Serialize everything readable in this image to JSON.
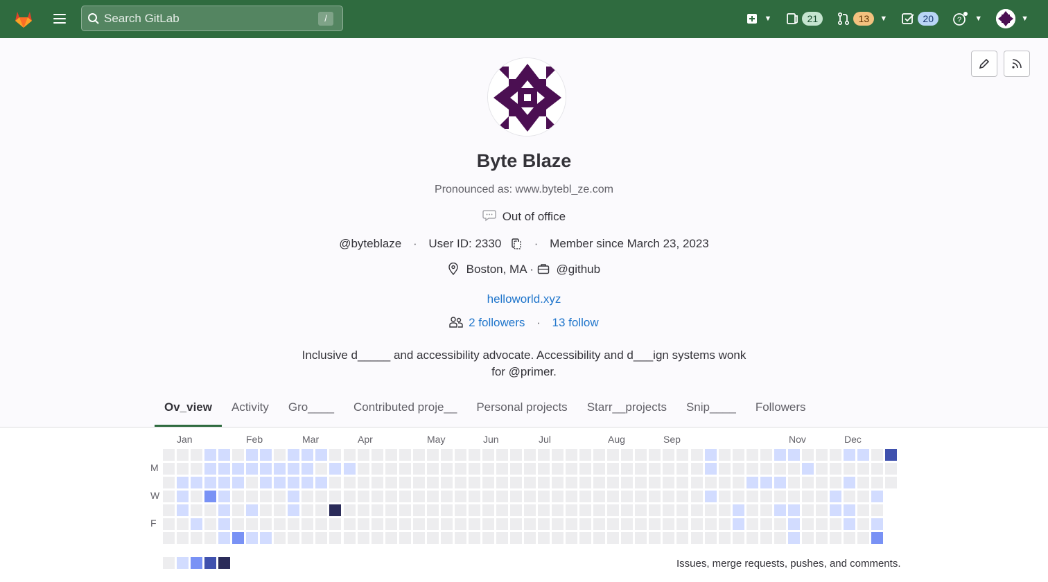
{
  "topbar": {
    "search_placeholder": "Search GitLab",
    "search_shortcut": "/",
    "issues_count": "21",
    "merge_requests_count": "13",
    "todos_count": "20"
  },
  "profile": {
    "name": "Byte Blaze",
    "pronounced": "Pronounced as: www.bytebl_ze.com",
    "status_text": "Out of office",
    "username": "@byteblaze",
    "user_id": "User ID: 2330",
    "member_since": "Member since March 23, 2023",
    "location": "Boston, MA",
    "organization": "@github",
    "website": "helloworld.xyz",
    "followers": "2 followers",
    "following": "13 follow",
    "bio": "Inclusive d_____ and accessibility advocate. Accessibility and d___ign systems wonk for @primer."
  },
  "tabs": [
    "Ov_view",
    "Activity",
    "Gro____",
    "Contributed proje__",
    "Personal projects",
    "Starr__projects",
    "Snip____",
    "Followers"
  ],
  "calendar": {
    "months": [
      "Jan",
      "Feb",
      "Mar",
      "Apr",
      "May",
      "Jun",
      "Jul",
      "Aug",
      "Sep",
      "Nov",
      "Dec"
    ],
    "day_labels": [
      "M",
      "W",
      "F"
    ],
    "note": "Issues, merge requests, pushes, and comments.",
    "colors": [
      "#ededef",
      "#d2dcff",
      "#7992f5",
      "#3f51ae",
      "#2a2b59"
    ],
    "legend_levels": [
      0,
      1,
      2,
      3,
      4
    ]
  }
}
